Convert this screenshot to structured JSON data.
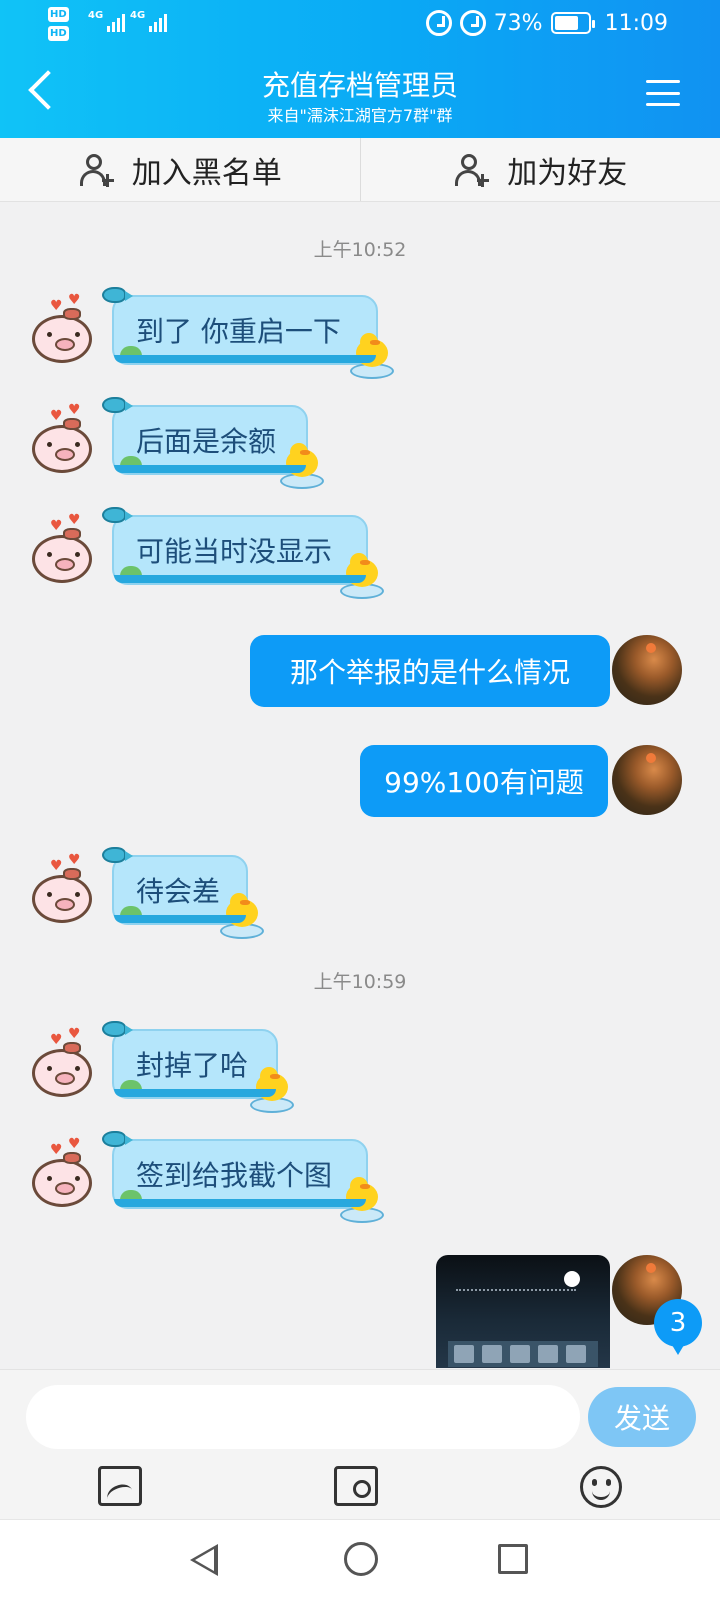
{
  "status_bar": {
    "hd1": "HD",
    "hd2": "HD",
    "net1": "4G",
    "net2": "4G",
    "battery": "73%",
    "battery_level": 0.73,
    "time": "11:09"
  },
  "header": {
    "title": "充值存档管理员",
    "subtitle": "来自\"濡沫江湖官方7群\"群"
  },
  "actions": {
    "blacklist": "加入黑名单",
    "add_friend": "加为好友"
  },
  "chat": {
    "timestamps": [
      "上午10:52",
      "上午10:59"
    ],
    "received": [
      "到了 你重启一下",
      "后面是余额",
      "可能当时没显示",
      "待会差",
      "封掉了哈",
      "签到给我截个图"
    ],
    "sent": [
      "那个举报的是什么情况",
      "99%100有问题"
    ],
    "unread_badge": "3"
  },
  "composer": {
    "input_placeholder": "",
    "send_label": "发送"
  },
  "icons": {
    "back": "back-icon",
    "menu": "menu-icon",
    "image": "image-icon",
    "camera": "camera-icon",
    "emoji": "emoji-icon"
  },
  "colors": {
    "header_bg": "#0aa9f5",
    "sent_bubble": "#0d9bf7",
    "received_bubble": "#b5e6fb",
    "send_button": "#7ec6f5"
  }
}
